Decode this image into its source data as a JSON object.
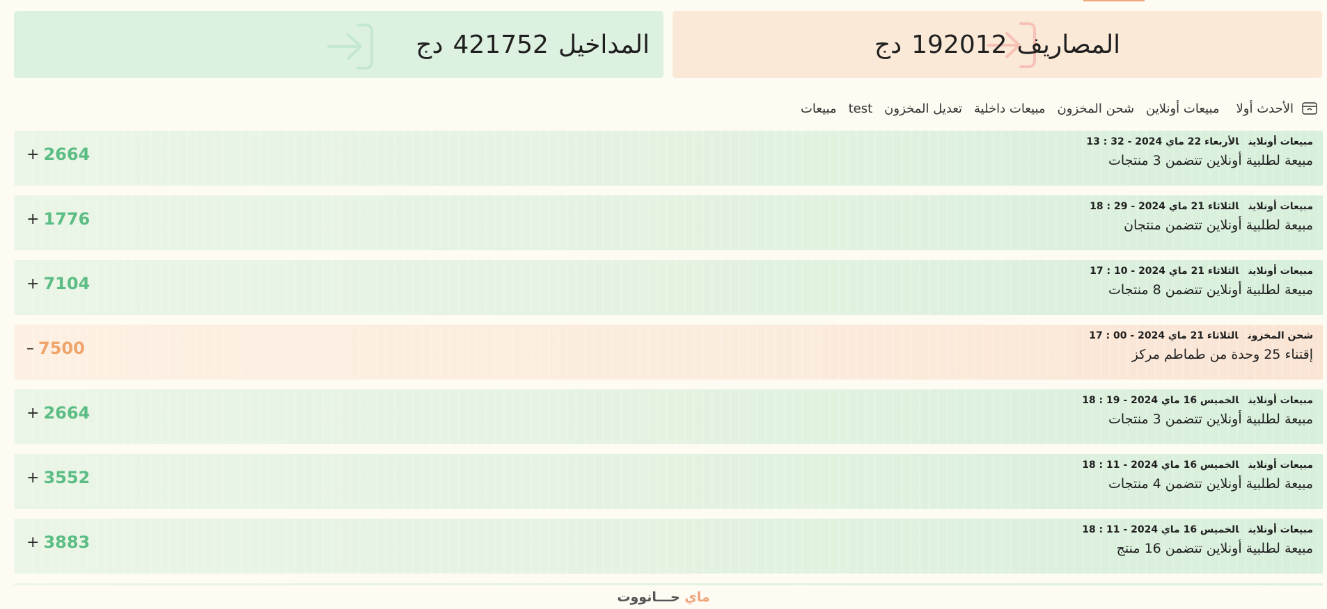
{
  "summary": {
    "expenses": {
      "label": "المصاريف",
      "amount": "192012",
      "currency": "دج",
      "icon": "logout-icon",
      "color": "#fbe9d8"
    },
    "income": {
      "label": "المداخيل",
      "amount": "421752",
      "currency": "دج",
      "icon": "login-icon",
      "color": "#ddf1e1"
    }
  },
  "filters": {
    "sort_label": "الأحدث أولا",
    "sort_icon": "archive-icon",
    "tabs": [
      "مبيعات أونلاين",
      "شحن المخزون",
      "مبيعات داخلية",
      "تعديل المخزون",
      "test",
      "مبيعات"
    ]
  },
  "transactions": [
    {
      "type": "مبيعات أونلاين",
      "datetime": "الأربعاء  22 ماي 2024 - 32 : 13",
      "description": "مبيعة لطلبية أونلاين تتضمن  3  منتجات",
      "sign": "+",
      "amount": "2664",
      "direction": "in"
    },
    {
      "type": "مبيعات أونلاين",
      "datetime": "الثلاثاء  21 ماي 2024 - 29 : 18",
      "description": "مبيعة لطلبية أونلاين تتضمن منتجان",
      "sign": "+",
      "amount": "1776",
      "direction": "in"
    },
    {
      "type": "مبيعات أونلاين",
      "datetime": "الثلاثاء  21 ماي 2024 - 10 : 17",
      "description": "مبيعة لطلبية أونلاين تتضمن  8  منتجات",
      "sign": "+",
      "amount": "7104",
      "direction": "in"
    },
    {
      "type": "شحن المخزون",
      "datetime": "الثلاثاء  21 ماي 2024 - 00 : 17",
      "description": "إقتناء 25  وحدة  من طماطم مركز",
      "sign": "–",
      "amount": "7500",
      "direction": "out"
    },
    {
      "type": "مبيعات أونلاين",
      "datetime": "الخميس  16 ماي 2024 - 19 : 18",
      "description": "مبيعة لطلبية أونلاين تتضمن  3  منتجات",
      "sign": "+",
      "amount": "2664",
      "direction": "in"
    },
    {
      "type": "مبيعات أونلاين",
      "datetime": "الخميس  16 ماي 2024 - 11 : 18",
      "description": "مبيعة لطلبية أونلاين تتضمن  4  منتجات",
      "sign": "+",
      "amount": "3552",
      "direction": "in"
    },
    {
      "type": "مبيعات أونلاين",
      "datetime": "الخميس  16 ماي 2024 - 11 : 18",
      "description": "مبيعة لطلبية أونلاين تتضمن  16  منتج",
      "sign": "+",
      "amount": "3883",
      "direction": "in"
    }
  ],
  "footer": {
    "brand_part1": "ماي",
    "brand_part2": "حـــانووت"
  },
  "colors": {
    "income_green": "#5cbd84",
    "expense_orange": "#eea46a",
    "page_bg": "#fdfbf2"
  }
}
